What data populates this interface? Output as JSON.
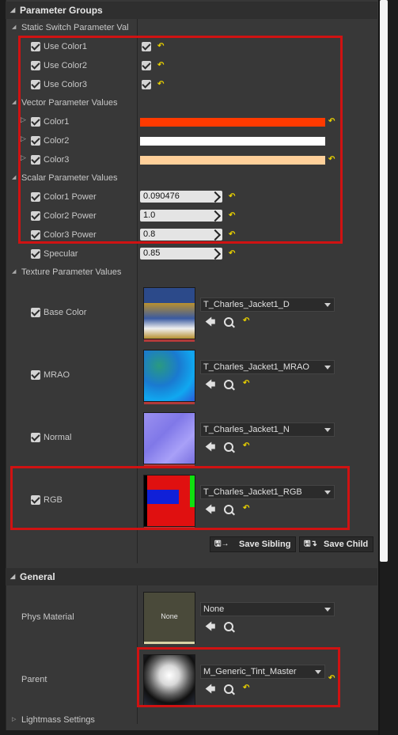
{
  "categories": {
    "parameter_groups": "Parameter Groups",
    "general": "General"
  },
  "subcategories": {
    "static_switch": "Static Switch Parameter Val",
    "vector": "Vector Parameter Values",
    "scalar": "Scalar Parameter Values",
    "texture": "Texture Parameter Values",
    "lightmass": "Lightmass Settings"
  },
  "static_switch_params": [
    {
      "label": "Use Color1"
    },
    {
      "label": "Use Color2"
    },
    {
      "label": "Use Color3"
    }
  ],
  "vector_params": [
    {
      "label": "Color1",
      "color": "#ff3a00"
    },
    {
      "label": "Color2",
      "color": "#ffffff"
    },
    {
      "label": "Color3",
      "color": "#ffd09a"
    }
  ],
  "scalar_params": [
    {
      "label": "Color1 Power",
      "value": "0.090476"
    },
    {
      "label": "Color2 Power",
      "value": "1.0"
    },
    {
      "label": "Color3 Power",
      "value": "0.8"
    },
    {
      "label": "Specular",
      "value": "0.85"
    }
  ],
  "texture_params": [
    {
      "label": "Base Color",
      "texture": "T_Charles_Jacket1_D"
    },
    {
      "label": "MRAO",
      "texture": "T_Charles_Jacket1_MRAO"
    },
    {
      "label": "Normal",
      "texture": "T_Charles_Jacket1_N"
    },
    {
      "label": "RGB",
      "texture": "T_Charles_Jacket1_RGB"
    }
  ],
  "buttons": {
    "save_sibling": "Save Sibling",
    "save_child": "Save Child"
  },
  "general": {
    "phys_material_label": "Phys Material",
    "phys_material_value": "None",
    "phys_thumb_text": "None",
    "parent_label": "Parent",
    "parent_value": "M_Generic_Tint_Master"
  },
  "icons": {
    "reset": "reset-to-default-icon",
    "browse": "browse-arrow-icon",
    "find": "find-in-browser-icon",
    "scrub": "scrub-arrow-icon"
  },
  "colors": {
    "highlight": "#d01212",
    "reset": "#e8d000"
  }
}
